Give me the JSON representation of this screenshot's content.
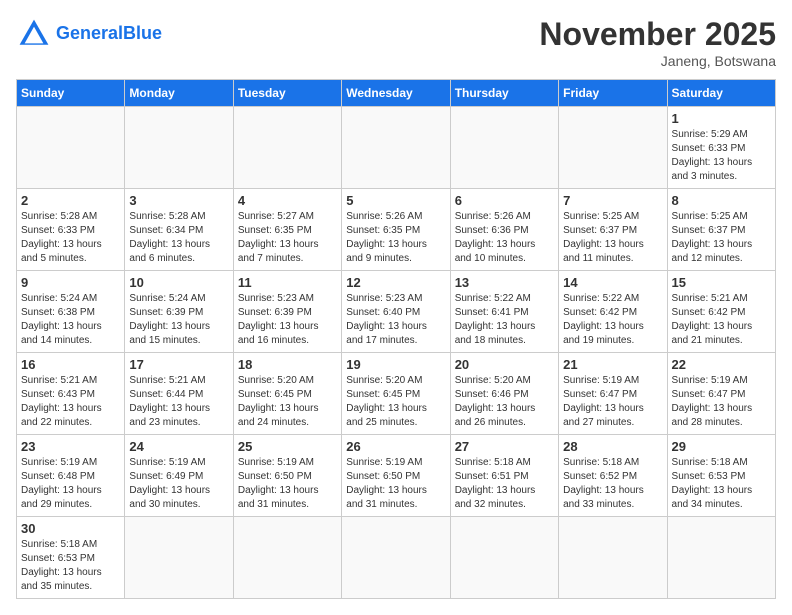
{
  "header": {
    "logo_general": "General",
    "logo_blue": "Blue",
    "month_title": "November 2025",
    "location": "Janeng, Botswana"
  },
  "days_of_week": [
    "Sunday",
    "Monday",
    "Tuesday",
    "Wednesday",
    "Thursday",
    "Friday",
    "Saturday"
  ],
  "weeks": [
    [
      {
        "day": "",
        "info": ""
      },
      {
        "day": "",
        "info": ""
      },
      {
        "day": "",
        "info": ""
      },
      {
        "day": "",
        "info": ""
      },
      {
        "day": "",
        "info": ""
      },
      {
        "day": "",
        "info": ""
      },
      {
        "day": "1",
        "info": "Sunrise: 5:29 AM\nSunset: 6:33 PM\nDaylight: 13 hours\nand 3 minutes."
      }
    ],
    [
      {
        "day": "2",
        "info": "Sunrise: 5:28 AM\nSunset: 6:33 PM\nDaylight: 13 hours\nand 5 minutes."
      },
      {
        "day": "3",
        "info": "Sunrise: 5:28 AM\nSunset: 6:34 PM\nDaylight: 13 hours\nand 6 minutes."
      },
      {
        "day": "4",
        "info": "Sunrise: 5:27 AM\nSunset: 6:35 PM\nDaylight: 13 hours\nand 7 minutes."
      },
      {
        "day": "5",
        "info": "Sunrise: 5:26 AM\nSunset: 6:35 PM\nDaylight: 13 hours\nand 9 minutes."
      },
      {
        "day": "6",
        "info": "Sunrise: 5:26 AM\nSunset: 6:36 PM\nDaylight: 13 hours\nand 10 minutes."
      },
      {
        "day": "7",
        "info": "Sunrise: 5:25 AM\nSunset: 6:37 PM\nDaylight: 13 hours\nand 11 minutes."
      },
      {
        "day": "8",
        "info": "Sunrise: 5:25 AM\nSunset: 6:37 PM\nDaylight: 13 hours\nand 12 minutes."
      }
    ],
    [
      {
        "day": "9",
        "info": "Sunrise: 5:24 AM\nSunset: 6:38 PM\nDaylight: 13 hours\nand 14 minutes."
      },
      {
        "day": "10",
        "info": "Sunrise: 5:24 AM\nSunset: 6:39 PM\nDaylight: 13 hours\nand 15 minutes."
      },
      {
        "day": "11",
        "info": "Sunrise: 5:23 AM\nSunset: 6:39 PM\nDaylight: 13 hours\nand 16 minutes."
      },
      {
        "day": "12",
        "info": "Sunrise: 5:23 AM\nSunset: 6:40 PM\nDaylight: 13 hours\nand 17 minutes."
      },
      {
        "day": "13",
        "info": "Sunrise: 5:22 AM\nSunset: 6:41 PM\nDaylight: 13 hours\nand 18 minutes."
      },
      {
        "day": "14",
        "info": "Sunrise: 5:22 AM\nSunset: 6:42 PM\nDaylight: 13 hours\nand 19 minutes."
      },
      {
        "day": "15",
        "info": "Sunrise: 5:21 AM\nSunset: 6:42 PM\nDaylight: 13 hours\nand 21 minutes."
      }
    ],
    [
      {
        "day": "16",
        "info": "Sunrise: 5:21 AM\nSunset: 6:43 PM\nDaylight: 13 hours\nand 22 minutes."
      },
      {
        "day": "17",
        "info": "Sunrise: 5:21 AM\nSunset: 6:44 PM\nDaylight: 13 hours\nand 23 minutes."
      },
      {
        "day": "18",
        "info": "Sunrise: 5:20 AM\nSunset: 6:45 PM\nDaylight: 13 hours\nand 24 minutes."
      },
      {
        "day": "19",
        "info": "Sunrise: 5:20 AM\nSunset: 6:45 PM\nDaylight: 13 hours\nand 25 minutes."
      },
      {
        "day": "20",
        "info": "Sunrise: 5:20 AM\nSunset: 6:46 PM\nDaylight: 13 hours\nand 26 minutes."
      },
      {
        "day": "21",
        "info": "Sunrise: 5:19 AM\nSunset: 6:47 PM\nDaylight: 13 hours\nand 27 minutes."
      },
      {
        "day": "22",
        "info": "Sunrise: 5:19 AM\nSunset: 6:47 PM\nDaylight: 13 hours\nand 28 minutes."
      }
    ],
    [
      {
        "day": "23",
        "info": "Sunrise: 5:19 AM\nSunset: 6:48 PM\nDaylight: 13 hours\nand 29 minutes."
      },
      {
        "day": "24",
        "info": "Sunrise: 5:19 AM\nSunset: 6:49 PM\nDaylight: 13 hours\nand 30 minutes."
      },
      {
        "day": "25",
        "info": "Sunrise: 5:19 AM\nSunset: 6:50 PM\nDaylight: 13 hours\nand 31 minutes."
      },
      {
        "day": "26",
        "info": "Sunrise: 5:19 AM\nSunset: 6:50 PM\nDaylight: 13 hours\nand 31 minutes."
      },
      {
        "day": "27",
        "info": "Sunrise: 5:18 AM\nSunset: 6:51 PM\nDaylight: 13 hours\nand 32 minutes."
      },
      {
        "day": "28",
        "info": "Sunrise: 5:18 AM\nSunset: 6:52 PM\nDaylight: 13 hours\nand 33 minutes."
      },
      {
        "day": "29",
        "info": "Sunrise: 5:18 AM\nSunset: 6:53 PM\nDaylight: 13 hours\nand 34 minutes."
      }
    ],
    [
      {
        "day": "30",
        "info": "Sunrise: 5:18 AM\nSunset: 6:53 PM\nDaylight: 13 hours\nand 35 minutes."
      },
      {
        "day": "",
        "info": ""
      },
      {
        "day": "",
        "info": ""
      },
      {
        "day": "",
        "info": ""
      },
      {
        "day": "",
        "info": ""
      },
      {
        "day": "",
        "info": ""
      },
      {
        "day": "",
        "info": ""
      }
    ]
  ]
}
